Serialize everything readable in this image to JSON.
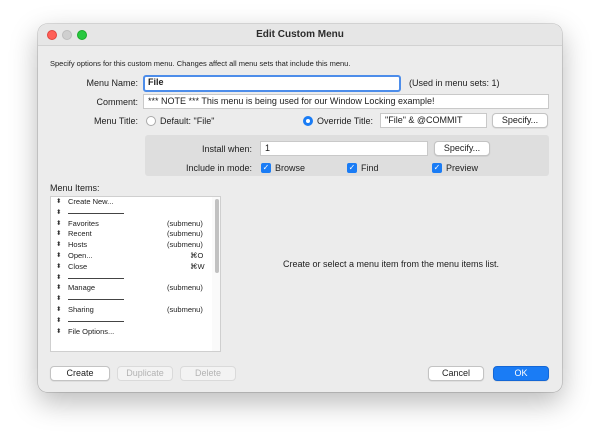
{
  "window": {
    "title": "Edit Custom Menu"
  },
  "intro": "Specify options for this custom menu.  Changes affect all menu sets that include this menu.",
  "menu_name": {
    "label": "Menu Name:",
    "value": "File",
    "used_in": "(Used in menu sets: 1)"
  },
  "comment": {
    "label": "Comment:",
    "value": "*** NOTE *** This menu is being used for our Window Locking example!"
  },
  "menu_title": {
    "label": "Menu Title:",
    "default_label": "Default: \"File\"",
    "override_label": "Override Title:",
    "override_value": "\"File\" & @COMMIT",
    "specify_label": "Specify..."
  },
  "install": {
    "when_label": "Install when:",
    "when_value": "1",
    "specify_label": "Specify...",
    "mode_label": "Include in mode:",
    "modes": [
      {
        "label": "Browse",
        "checked": true
      },
      {
        "label": "Find",
        "checked": true
      },
      {
        "label": "Preview",
        "checked": true
      }
    ]
  },
  "menu_items": {
    "label": "Menu Items:",
    "items": [
      {
        "name": "Create New...",
        "type": "",
        "shortcut": "",
        "separator": false
      },
      {
        "name": "",
        "type": "",
        "shortcut": "",
        "separator": true
      },
      {
        "name": "Favorites",
        "type": "(submenu)",
        "shortcut": "",
        "separator": false
      },
      {
        "name": "Recent",
        "type": "(submenu)",
        "shortcut": "",
        "separator": false
      },
      {
        "name": "Hosts",
        "type": "(submenu)",
        "shortcut": "",
        "separator": false
      },
      {
        "name": "Open...",
        "type": "",
        "shortcut": "⌘O",
        "separator": false
      },
      {
        "name": "Close",
        "type": "",
        "shortcut": "⌘W",
        "separator": false
      },
      {
        "name": "",
        "type": "",
        "shortcut": "",
        "separator": true
      },
      {
        "name": "Manage",
        "type": "(submenu)",
        "shortcut": "",
        "separator": false
      },
      {
        "name": "",
        "type": "",
        "shortcut": "",
        "separator": true
      },
      {
        "name": "Sharing",
        "type": "(submenu)",
        "shortcut": "",
        "separator": false
      },
      {
        "name": "",
        "type": "",
        "shortcut": "",
        "separator": true
      },
      {
        "name": "File Options...",
        "type": "",
        "shortcut": "",
        "separator": false
      }
    ],
    "empty_hint": "Create or select a menu item from the menu items list."
  },
  "footer": {
    "create": "Create",
    "duplicate": "Duplicate",
    "delete": "Delete",
    "cancel": "Cancel",
    "ok": "OK"
  },
  "colors": {
    "accent": "#1a7cf5",
    "focus": "#4d8dea",
    "window_bg": "#ececec"
  },
  "icons": {
    "drag_handle": "updown-arrows-icon",
    "checkmark": "checkmark-icon"
  }
}
